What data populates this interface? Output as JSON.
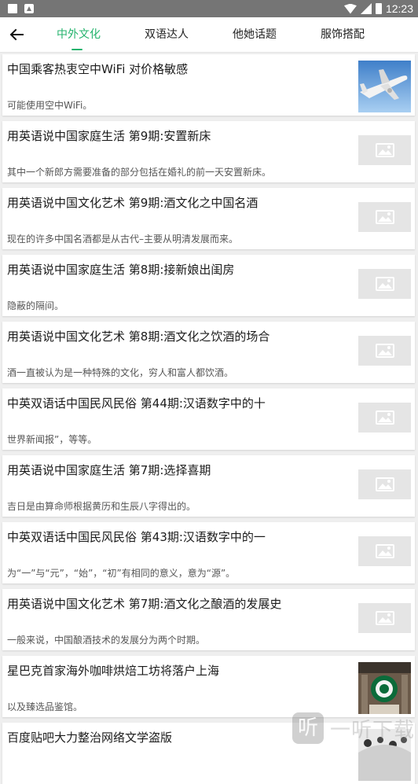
{
  "status_bar": {
    "time": "12:23",
    "icons": [
      "notification-icon",
      "app-icon",
      "wifi-icon",
      "signal-icon",
      "battery-icon"
    ]
  },
  "toolbar": {
    "back_icon": "arrow-left-icon",
    "tabs": [
      {
        "label": "中外文化",
        "active": true
      },
      {
        "label": "双语达人",
        "active": false
      },
      {
        "label": "他她话题",
        "active": false
      },
      {
        "label": "服饰搭配",
        "active": false
      }
    ],
    "accent_color": "#25b36d"
  },
  "articles": [
    {
      "title": "中国乘客热衷空中WiFi 对价格敏感",
      "summary": "可能使用空中WiFi。",
      "thumbnail": "airplane-photo"
    },
    {
      "title": "用英语说中国家庭生活 第9期:安置新床",
      "summary": "其中一个新郎方需要准备的部分包括在婚礼的前一天安置新床。",
      "thumbnail": "image-placeholder-icon"
    },
    {
      "title": "用英语说中国文化艺术 第9期:酒文化之中国名酒",
      "summary": "现在的许多中国名酒都是从古代–主要从明清发展而来。",
      "thumbnail": "image-placeholder-icon"
    },
    {
      "title": "用英语说中国家庭生活 第8期:接新娘出闺房",
      "summary": "隐蔽的隔间。",
      "thumbnail": "image-placeholder-icon"
    },
    {
      "title": "用英语说中国文化艺术 第8期:酒文化之饮酒的场合",
      "summary": "酒一直被认为是一种特殊的文化，穷人和富人都饮酒。",
      "thumbnail": "image-placeholder-icon"
    },
    {
      "title": "中英双语话中国民风民俗 第44期:汉语数字中的十",
      "summary": "世界新闻报”，等等。",
      "thumbnail": "image-placeholder-icon"
    },
    {
      "title": "用英语说中国家庭生活 第7期:选择喜期",
      "summary": "吉日是由算命师根据黄历和生辰八字得出的。",
      "thumbnail": "image-placeholder-icon"
    },
    {
      "title": "中英双语话中国民风民俗 第43期:汉语数字中的一",
      "summary": "为“一”与“元”，“始”，“初”有相同的意义，意为“源”。",
      "thumbnail": "image-placeholder-icon"
    },
    {
      "title": "用英语说中国文化艺术 第7期:酒文化之酿酒的发展史",
      "summary": "一般来说，中国酿酒技术的发展分为两个时期。",
      "thumbnail": "image-placeholder-icon"
    },
    {
      "title": "星巴克首家海外咖啡烘焙工坊将落户上海",
      "summary": "以及臻选品鉴馆。",
      "thumbnail": "starbucks-photo"
    },
    {
      "title": "百度贴吧大力整治网络文学盗版",
      "summary": "",
      "thumbnail": "photo"
    }
  ],
  "watermark": {
    "logo": "听",
    "text": "一听下载"
  }
}
